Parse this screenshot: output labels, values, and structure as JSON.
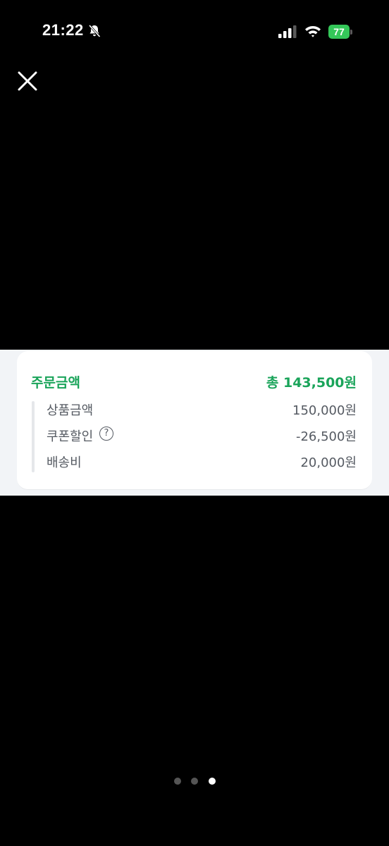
{
  "status_bar": {
    "time": "21:22",
    "battery": "77",
    "icons": [
      "bell-off-icon",
      "cellular-signal-icon",
      "wifi-icon",
      "battery-charging-icon"
    ]
  },
  "viewer": {
    "close_icon": "close-icon",
    "pager": {
      "total": 3,
      "active_index": 2
    }
  },
  "order": {
    "title": "주문금액",
    "total": "총 143,500원",
    "accent_color": "#1aa45a",
    "items": [
      {
        "label": "상품금액",
        "value": "150,000원"
      },
      {
        "label": "쿠폰할인",
        "value": "-26,500원",
        "help": "?"
      },
      {
        "label": "배송비",
        "value": "20,000원"
      }
    ]
  }
}
